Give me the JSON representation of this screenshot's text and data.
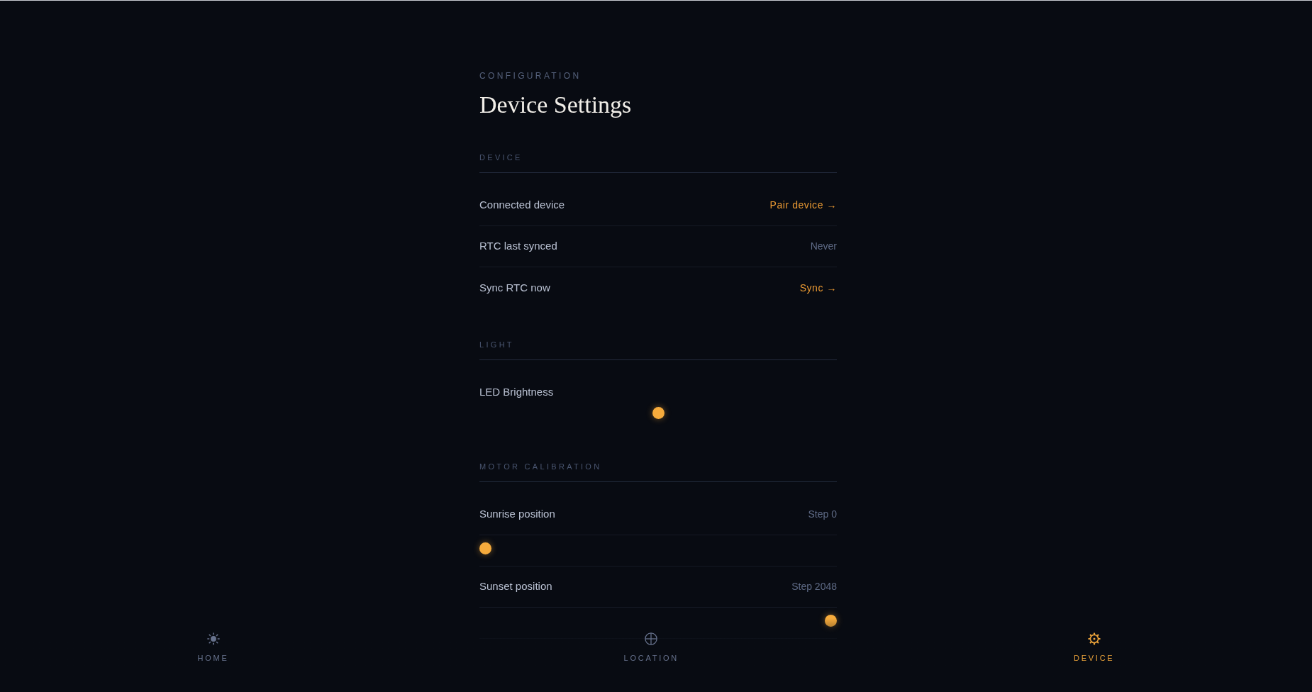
{
  "header": {
    "eyebrow": "CONFIGURATION",
    "title": "Device Settings"
  },
  "sections": [
    {
      "heading": "DEVICE",
      "rows": [
        {
          "kind": "action",
          "label": "Connected device",
          "action": "Pair device →"
        },
        {
          "kind": "value",
          "label": "RTC last synced",
          "value": "Never"
        },
        {
          "kind": "action",
          "label": "Sync RTC now",
          "action": "Sync →"
        }
      ]
    },
    {
      "heading": "LIGHT",
      "rows": [
        {
          "kind": "slider",
          "label": "LED Brightness",
          "level": 0.5
        }
      ]
    },
    {
      "heading": "MOTOR CALIBRATION",
      "rows": [
        {
          "kind": "value",
          "label": "Sunrise position",
          "value": "Step 0"
        },
        {
          "kind": "slider",
          "level": 0
        },
        {
          "kind": "value",
          "label": "Sunset position",
          "value": "Step 2048"
        },
        {
          "kind": "slider",
          "level": 1
        }
      ]
    }
  ],
  "nav": [
    {
      "kind": "sun",
      "label": "HOME",
      "selected": false
    },
    {
      "kind": "globe",
      "label": "LOCATION",
      "selected": false
    },
    {
      "kind": "gear",
      "label": "DEVICE",
      "selected": true
    }
  ]
}
